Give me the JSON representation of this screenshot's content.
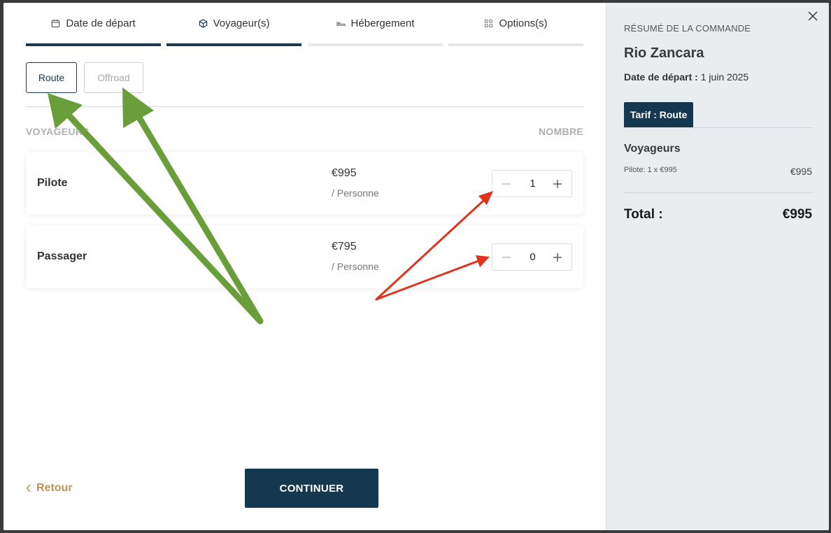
{
  "steps": [
    {
      "label": "Date de départ",
      "icon": "calendar-icon",
      "done": true
    },
    {
      "label": "Voyageur(s)",
      "icon": "cube-icon",
      "done": true
    },
    {
      "label": "Hébergement",
      "icon": "bed-icon",
      "done": false
    },
    {
      "label": "Options(s)",
      "icon": "grid-icon",
      "done": false
    }
  ],
  "tarifs": {
    "route": "Route",
    "offroad": "Offroad"
  },
  "columns": {
    "voyageurs": "VOYAGEURS",
    "nombre": "NOMBRE"
  },
  "travelers": [
    {
      "name": "Pilote",
      "price": "€995",
      "per": "/ Personne",
      "qty": "1"
    },
    {
      "name": "Passager",
      "price": "€795",
      "per": "/ Personne",
      "qty": "0"
    }
  ],
  "footer": {
    "back": "Retour",
    "continue": "CONTINUER"
  },
  "summary": {
    "title": "RÉSUMÉ DE LA COMMANDE",
    "name": "Rio Zancara",
    "date_label": "Date de départ :",
    "date_value": "1 juin 2025",
    "tag": "Tarif : Route",
    "voyageurs_heading": "Voyageurs",
    "line_label": "Pilote: 1 x €995",
    "line_price": "€995",
    "total_label": "Total :",
    "total_value": "€995"
  },
  "colors": {
    "primary": "#14384f",
    "accent_back": "#b8955a",
    "annotation_green": "#6a9e3a",
    "annotation_red": "#e0321c",
    "summary_bg": "#e9edf0"
  }
}
